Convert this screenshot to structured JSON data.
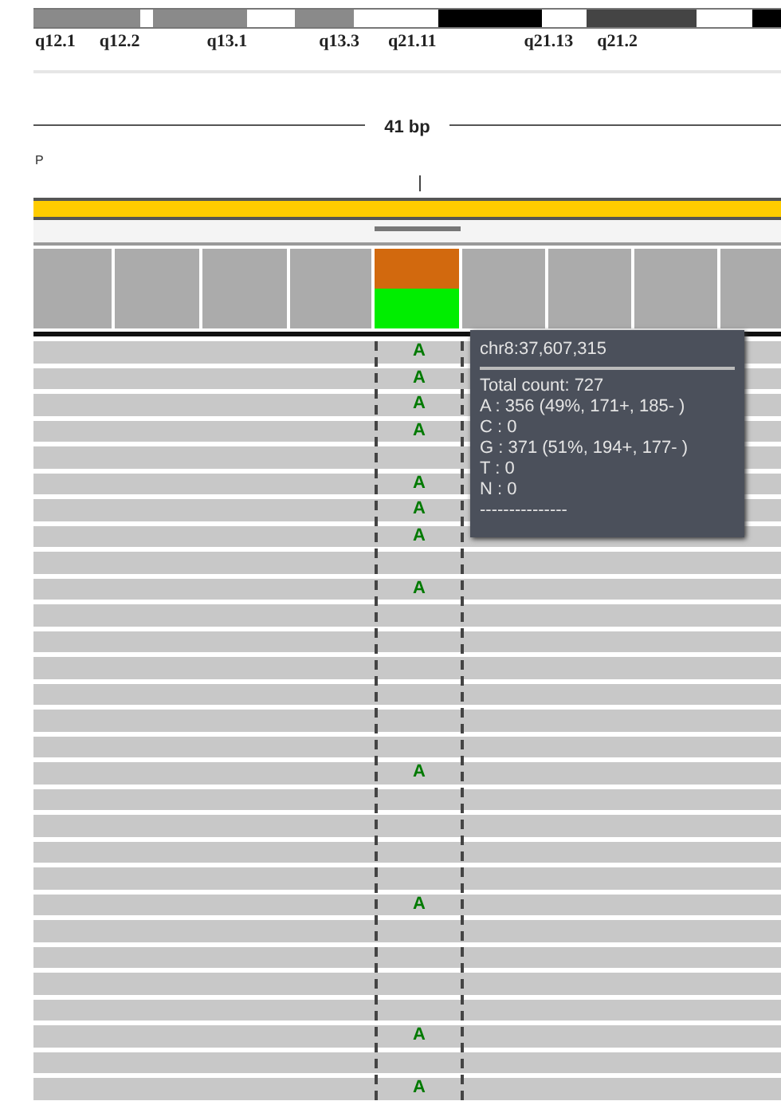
{
  "ideogram": {
    "bands": [
      {
        "color": "#8a8a8a"
      },
      {
        "color": "#ffffff"
      },
      {
        "color": "#8a8a8a"
      },
      {
        "color": "#ffffff"
      },
      {
        "color": "#8a8a8a"
      },
      {
        "color": "#ffffff"
      },
      {
        "color": "#000000"
      },
      {
        "color": "#ffffff"
      },
      {
        "color": "#444444"
      },
      {
        "color": "#ffffff"
      },
      {
        "color": "#000000"
      }
    ],
    "labels": [
      "q12.1",
      "q12.2",
      "q13.1",
      "q13.3",
      "q21.11",
      "q21.13",
      "q21.2"
    ]
  },
  "ruler": {
    "span": "41 bp",
    "track_label": "P"
  },
  "coverage": [
    {
      "mismatch": false
    },
    {
      "mismatch": false
    },
    {
      "mismatch": false
    },
    {
      "mismatch": false
    },
    {
      "mismatch": true
    },
    {
      "mismatch": false
    },
    {
      "mismatch": false
    },
    {
      "mismatch": false
    },
    {
      "mismatch": false
    }
  ],
  "reads": [
    {
      "kind": "mismatch",
      "base": "A"
    },
    {
      "kind": "mismatch",
      "base": "A"
    },
    {
      "kind": "mismatch",
      "base": "A"
    },
    {
      "kind": "mismatch",
      "base": "A"
    },
    {
      "kind": "match"
    },
    {
      "kind": "mismatch",
      "base": "A"
    },
    {
      "kind": "mismatch",
      "base": "A"
    },
    {
      "kind": "mismatch",
      "base": "A"
    },
    {
      "kind": "match"
    },
    {
      "kind": "mismatch",
      "base": "A"
    },
    {
      "kind": "match"
    },
    {
      "kind": "match"
    },
    {
      "kind": "match"
    },
    {
      "kind": "match"
    },
    {
      "kind": "match"
    },
    {
      "kind": "match"
    },
    {
      "kind": "mismatch",
      "base": "A"
    },
    {
      "kind": "match"
    },
    {
      "kind": "match"
    },
    {
      "kind": "match"
    },
    {
      "kind": "match"
    },
    {
      "kind": "mismatch",
      "base": "A"
    },
    {
      "kind": "match"
    },
    {
      "kind": "match"
    },
    {
      "kind": "match"
    },
    {
      "kind": "match"
    },
    {
      "kind": "mismatch",
      "base": "A"
    },
    {
      "kind": "match"
    },
    {
      "kind": "mismatch",
      "base": "A"
    }
  ],
  "tooltip": {
    "title": "chr8:37,607,315",
    "lines": [
      "Total count: 727",
      "A : 356 (49%, 171+, 185- )",
      "C : 0",
      "G : 371 (51%, 194+, 177- )",
      "T : 0",
      "N : 0",
      "---------------"
    ]
  }
}
